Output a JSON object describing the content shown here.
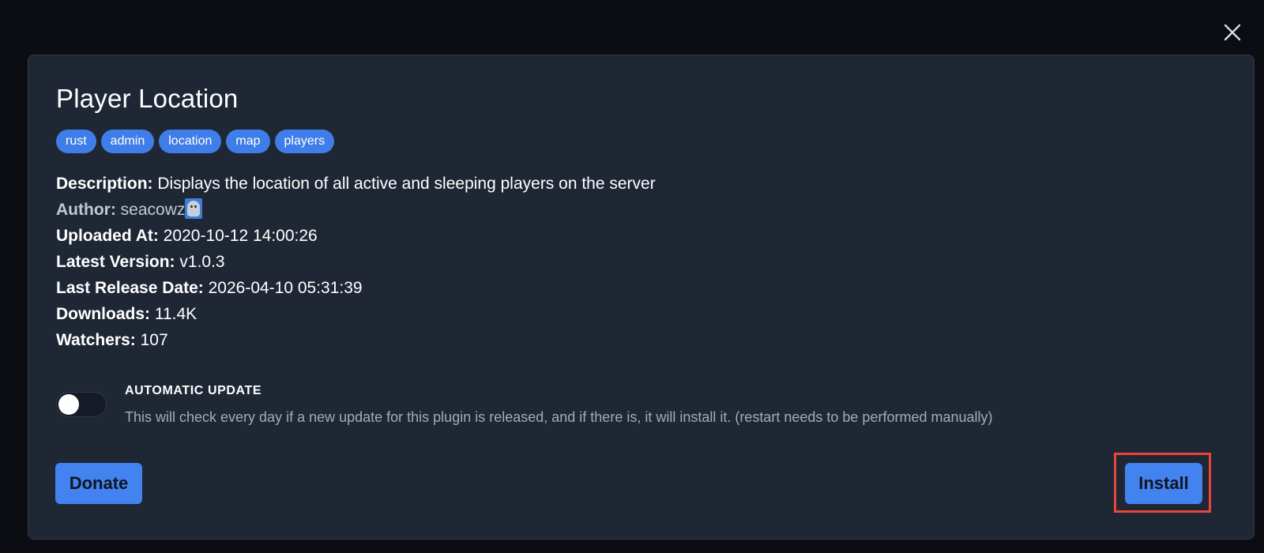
{
  "modal": {
    "title": "Player Location",
    "tags": [
      "rust",
      "admin",
      "location",
      "map",
      "players"
    ],
    "info": {
      "description_label": "Description:",
      "description_value": "Displays the location of all active and sleeping players on the server",
      "author_label": "Author:",
      "author_value": "seacowz",
      "uploaded_label": "Uploaded At:",
      "uploaded_value": "2020-10-12 14:00:26",
      "version_label": "Latest Version:",
      "version_value": "v1.0.3",
      "release_label": "Last Release Date:",
      "release_value": "2026-04-10 05:31:39",
      "downloads_label": "Downloads:",
      "downloads_value": "11.4K",
      "watchers_label": "Watchers:",
      "watchers_value": "107"
    },
    "auto_update": {
      "title": "AUTOMATIC UPDATE",
      "description": "This will check every day if a new update for this plugin is released, and if there is, it will install it. (restart needs to be performed manually)",
      "enabled": false
    },
    "buttons": {
      "donate": "Donate",
      "install": "Install"
    }
  },
  "icons": {
    "close": "close-icon",
    "avatar": "author-avatar-icon"
  },
  "colors": {
    "accent": "#4283f0",
    "modal_bg": "#1f2735",
    "highlight": "#e8463a"
  }
}
